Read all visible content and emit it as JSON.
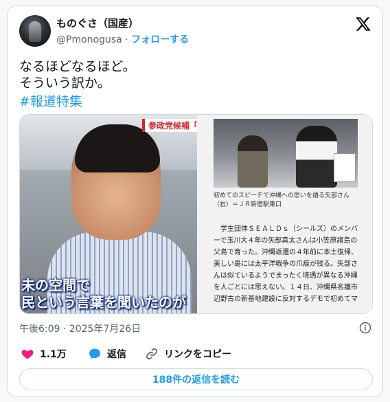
{
  "author": {
    "name": "ものぐさ（国産）",
    "handle": "@Pmonogusa",
    "separator": " · ",
    "follow_label": "フォローする"
  },
  "tweet": {
    "text": "なるほどなるほど。\nそういう訳か。",
    "hashtag": "#報道特集"
  },
  "media": {
    "left_overlay_label": "参政党候補「未",
    "left_caption_line1": "未の空間で",
    "left_caption_line2": "民という言葉を聞いたのが",
    "right_photo_caption": "初めてのスピーチで沖縄への思いを語る矢部さん（右）＝ＪＲ新宿駅東口",
    "right_article_text": "　学生団体ＳＥＡＬＤｓ（シールズ）のメンバーで玉川大４年の矢部真太さんは小笠原諸島の父島で育った。沖縄返還の４年前に本土復帰、美しい島には太平洋戦争の爪痕が残る。矢部さんは似ているようでまったく境遇が異なる沖縄を人ごとには思えない。１４日、沖縄県名護市辺野古の新基地建設に反対するデモで初めてマ"
  },
  "timestamp": "午後6:09 · 2025年7月26日",
  "actions": {
    "like_count": "1.1万",
    "reply_label": "返信",
    "copy_link_label": "リンクをコピー"
  },
  "read_replies_label": "188件の返信を読む",
  "colors": {
    "accent": "#1d9bf0",
    "like": "#f91880",
    "text": "#0f1419",
    "muted": "#536471"
  },
  "icons": [
    "x-logo-icon",
    "info-icon",
    "heart-icon",
    "reply-bubble-icon",
    "link-icon"
  ]
}
